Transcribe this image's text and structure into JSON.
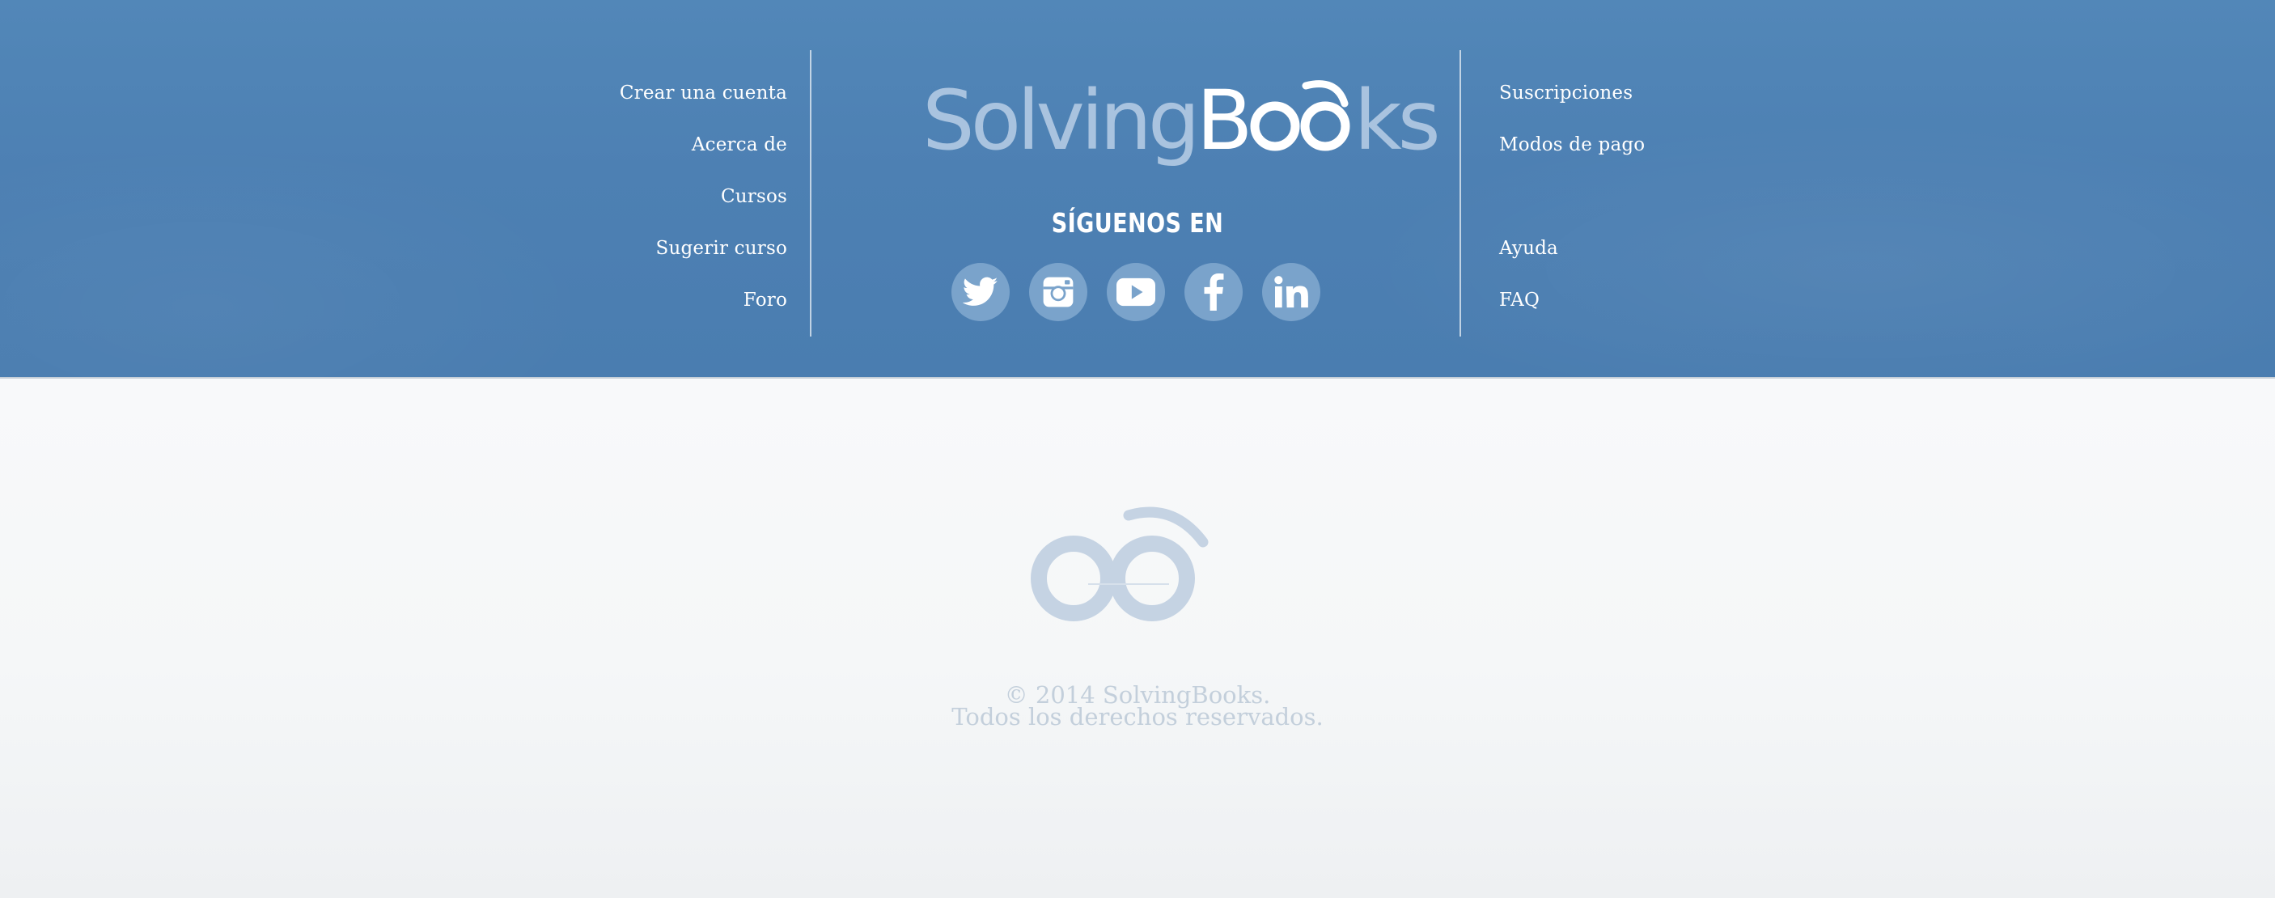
{
  "footer": {
    "left_nav": [
      {
        "label": "Crear una cuenta"
      },
      {
        "label": "Acerca de"
      },
      {
        "label": "Cursos"
      },
      {
        "label": "Sugerir curso"
      },
      {
        "label": "Foro"
      }
    ],
    "brand": {
      "name_part1": "Solving",
      "name_part2": "B",
      "name_part3": "ks"
    },
    "follow_label": "SÍGUENOS EN",
    "social": [
      {
        "name": "Twitter",
        "icon": "twitter-icon"
      },
      {
        "name": "Instagram",
        "icon": "instagram-icon"
      },
      {
        "name": "YouTube",
        "icon": "youtube-icon"
      },
      {
        "name": "Facebook",
        "icon": "facebook-icon"
      },
      {
        "name": "LinkedIn",
        "icon": "linkedin-icon"
      }
    ],
    "right_nav": [
      {
        "label": "Suscripciones"
      },
      {
        "label": "Modos de pago"
      },
      {
        "label": "Ayuda"
      },
      {
        "label": "FAQ"
      }
    ]
  },
  "bottom": {
    "copyright_line1": "© 2014 SolvingBooks.",
    "copyright_line2": "Todos los derechos reservados."
  },
  "colors": {
    "band_blue": "#4d80b3",
    "logo_light": "#a9c3df",
    "social_circle": "#7aa3cb",
    "emblem": "#c5d3e3",
    "copyright_text": "#c3cfdb"
  }
}
